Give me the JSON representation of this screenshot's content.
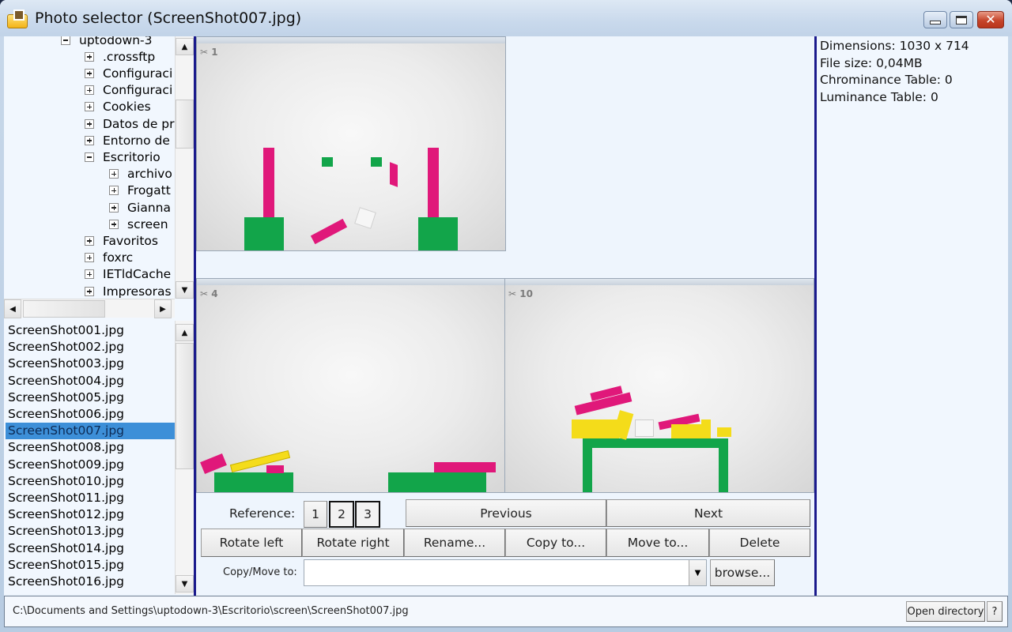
{
  "window": {
    "title": "Photo selector (ScreenShot007.jpg)",
    "controls": {
      "minimize": "minimize",
      "maximize": "maximize",
      "close": "✕"
    }
  },
  "tree": {
    "items": [
      {
        "label": "uptodown-3",
        "level": 0,
        "expanded": true
      },
      {
        "label": ".crossftp",
        "level": 1,
        "expanded": false
      },
      {
        "label": "Configuraci",
        "level": 1,
        "expanded": false
      },
      {
        "label": "Configuraci",
        "level": 1,
        "expanded": false
      },
      {
        "label": "Cookies",
        "level": 1,
        "expanded": false
      },
      {
        "label": "Datos de pr",
        "level": 1,
        "expanded": false
      },
      {
        "label": "Entorno de",
        "level": 1,
        "expanded": false
      },
      {
        "label": "Escritorio",
        "level": 1,
        "expanded": true
      },
      {
        "label": "archivo",
        "level": 2,
        "expanded": false
      },
      {
        "label": "Frogatt",
        "level": 2,
        "expanded": false
      },
      {
        "label": "Gianna",
        "level": 2,
        "expanded": false
      },
      {
        "label": "screen",
        "level": 2,
        "expanded": false
      },
      {
        "label": "Favoritos",
        "level": 1,
        "expanded": false
      },
      {
        "label": "foxrc",
        "level": 1,
        "expanded": false
      },
      {
        "label": "IETldCache",
        "level": 1,
        "expanded": false
      },
      {
        "label": "Impresoras",
        "level": 1,
        "expanded": false
      }
    ]
  },
  "files": {
    "selected": "ScreenShot007.jpg",
    "items": [
      "ScreenShot001.jpg",
      "ScreenShot002.jpg",
      "ScreenShot003.jpg",
      "ScreenShot004.jpg",
      "ScreenShot005.jpg",
      "ScreenShot006.jpg",
      "ScreenShot007.jpg",
      "ScreenShot008.jpg",
      "ScreenShot009.jpg",
      "ScreenShot010.jpg",
      "ScreenShot011.jpg",
      "ScreenShot012.jpg",
      "ScreenShot013.jpg",
      "ScreenShot014.jpg",
      "ScreenShot015.jpg",
      "ScreenShot016.jpg"
    ]
  },
  "previews": [
    {
      "slot": "main",
      "counter": "1"
    },
    {
      "slot": "reference-left",
      "counter": "4"
    },
    {
      "slot": "reference-right",
      "counter": "10"
    }
  ],
  "controls": {
    "reference_label": "Reference:",
    "reference_buttons": [
      "1",
      "2",
      "3"
    ],
    "reference_pressed": [
      "2",
      "3"
    ],
    "previous": "Previous",
    "next": "Next",
    "rotate_left": "Rotate left",
    "rotate_right": "Rotate right",
    "rename": "Rename...",
    "copy_to": "Copy to...",
    "move_to": "Move to...",
    "delete": "Delete",
    "copy_move_label": "Copy/Move to:",
    "copy_move_value": "",
    "browse": "browse..."
  },
  "info": {
    "dimensions": "Dimensions: 1030 x 714",
    "file_size": "File size: 0,04MB",
    "chrominance": "Chrominance Table: 0",
    "luminance": "Luminance Table: 0"
  },
  "status": {
    "path": "C:\\Documents and Settings\\uptodown-3\\Escritorio\\screen\\ScreenShot007.jpg",
    "open_directory": "Open directory",
    "help": "?"
  },
  "colors": {
    "selection": "#3d8fd8",
    "divider": "#1a1a8c",
    "magenta": "#e0187a",
    "green": "#12a54a",
    "yellow": "#f4dc1a"
  }
}
